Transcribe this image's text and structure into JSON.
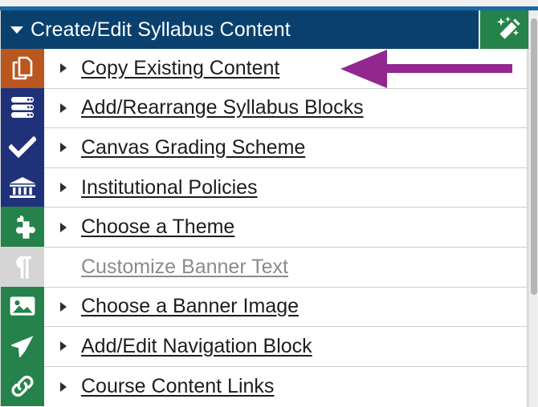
{
  "header": {
    "title": "Create/Edit Syllabus Content",
    "caret_icon": "caret-down-icon",
    "action_icon": "magic-wand-icon",
    "action_label": "",
    "bar_color": "#09406e",
    "action_color": "#25824a",
    "top_rule_color": "#1b6aa5"
  },
  "annotation": {
    "type": "arrow",
    "direction": "left",
    "color": "#92278f",
    "points_at": "Copy Existing Content"
  },
  "menu": {
    "items": [
      {
        "label": "Copy Existing Content",
        "icon": "copy-documents-icon",
        "icon_bg": "#b9571f",
        "has_disclosure": true,
        "enabled": true
      },
      {
        "label": "Add/Rearrange Syllabus Blocks",
        "icon": "server-stack-icon",
        "icon_bg": "#1f3179",
        "has_disclosure": true,
        "enabled": true
      },
      {
        "label": "Canvas Grading Scheme",
        "icon": "checkmark-icon",
        "icon_bg": "#1f3179",
        "has_disclosure": true,
        "enabled": true
      },
      {
        "label": "Institutional Policies",
        "icon": "bank-columns-icon",
        "icon_bg": "#1f3179",
        "has_disclosure": true,
        "enabled": true
      },
      {
        "label": "Choose a Theme",
        "icon": "puzzle-piece-icon",
        "icon_bg": "#25824a",
        "has_disclosure": true,
        "enabled": true
      },
      {
        "label": "Customize Banner Text",
        "icon": "pilcrow-icon",
        "icon_bg": "#d5d5d5",
        "has_disclosure": false,
        "enabled": false
      },
      {
        "label": "Choose a Banner Image",
        "icon": "image-photo-icon",
        "icon_bg": "#25824a",
        "has_disclosure": true,
        "enabled": true
      },
      {
        "label": "Add/Edit Navigation Block",
        "icon": "paper-plane-icon",
        "icon_bg": "#25824a",
        "has_disclosure": true,
        "enabled": true
      },
      {
        "label": "Course Content Links",
        "icon": "link-chain-icon",
        "icon_bg": "#25824a",
        "has_disclosure": true,
        "enabled": true
      }
    ]
  },
  "scrollbar": {
    "orientation": "vertical",
    "thumb_position": "top"
  }
}
